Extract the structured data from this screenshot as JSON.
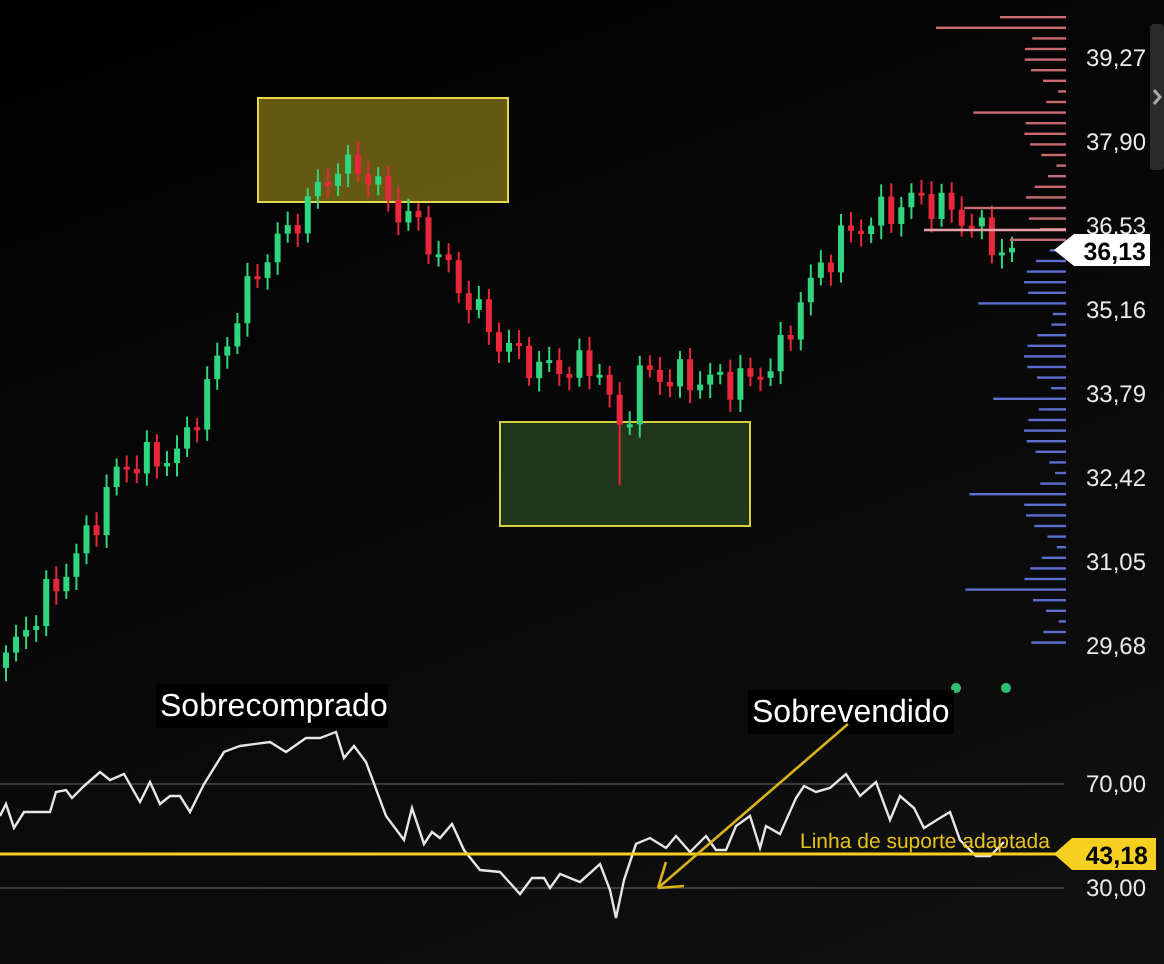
{
  "price_axis": {
    "ticks": [
      "39,27",
      "37,90",
      "36,53",
      "35,16",
      "33,79",
      "32,42",
      "31,05",
      "29,68"
    ],
    "current_price": "36,13"
  },
  "rsi_panel": {
    "ticks": [
      "70,00",
      "30,00"
    ],
    "current_value": "43,18"
  },
  "labels": {
    "overbought": "Sobrecomprado",
    "oversold": "Sobrevendido",
    "support_line": "Linha de suporte adaptada"
  }
}
